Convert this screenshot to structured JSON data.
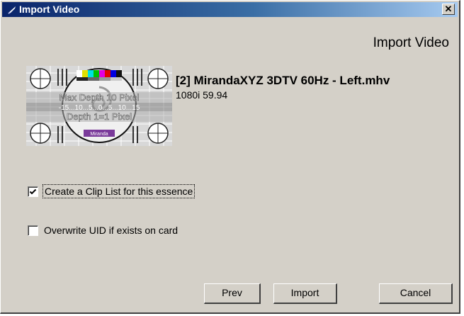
{
  "window": {
    "title": "Import Video",
    "close_label": "✕"
  },
  "header": {
    "heading": "Import Video"
  },
  "clip": {
    "name": "[2] MirandaXYZ 3DTV 60Hz - Left.mhv",
    "format": "1080i 59.94",
    "thumbnail": {
      "top_text": "Max Depth 10 Pixel",
      "scale_text": "-15...10...5...0...5...10...15",
      "bottom_text": "Depth 1=1 Pixel",
      "logo_text": "Miranda"
    }
  },
  "options": {
    "create_clip_list": {
      "label": "Create a Clip List for this essence",
      "checked": true
    },
    "overwrite_uid": {
      "label": "Overwrite UID if exists on card",
      "checked": false
    }
  },
  "buttons": {
    "prev": "Prev",
    "import": "Import",
    "cancel": "Cancel"
  },
  "colors": {
    "title_gradient_start": "#0a246a",
    "title_gradient_end": "#a6caf0",
    "dialog_bg": "#d4d0c8"
  }
}
